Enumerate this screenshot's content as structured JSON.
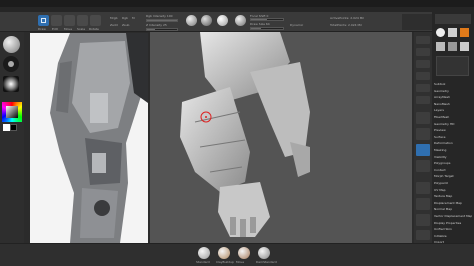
{
  "toolbar": {
    "draw_label": "Draw",
    "edit_label": "Edit",
    "move_label": "Move",
    "scale_label": "Scale",
    "rotate_label": "Rotate",
    "mrgb_label": "Mrgb",
    "rgb_label": "Rgb",
    "m_label": "M",
    "focal_label": "Focal Shift 0",
    "draw_size_label": "Draw Size 64",
    "z_intensity_label": "Z Intensity 25",
    "rgb_intensity_label": "Rgb Intensity 100",
    "zadd_label": "Zadd",
    "zsub_label": "Zsub",
    "dynamic_label": "Dynamic",
    "active_points": "ActivePoints: 2.024 Mil",
    "total_points": "TotalPoints: 2.024 Mil"
  },
  "bottom_brushes": [
    {
      "label": "Standard",
      "color": "#9c9c9c"
    },
    {
      "label": "ClayBuildup",
      "color": "#b08a62"
    },
    {
      "label": "Move",
      "color": "#a57a5a"
    },
    {
      "label": "DamStandard",
      "color": "#888888"
    }
  ],
  "right_menu": [
    "Subtool",
    "Geometry",
    "ArrayMesh",
    "NanoMesh",
    "Layers",
    "FiberMesh",
    "Geometry HD",
    "Preview",
    "Surface",
    "Deformation",
    "Masking",
    "Visibility",
    "Polygroups",
    "Contact",
    "Morph Target",
    "Polypaint",
    "UV Map",
    "Texture Map",
    "Displacement Map",
    "Normal Map",
    "Vector Displacement Map",
    "Display Properties",
    "Unified Skin",
    "Initialize",
    "Import",
    "Export"
  ],
  "colors": {
    "accent": "#2f6fb0",
    "active_orange": "#e07a1a",
    "viewport": "#545454"
  }
}
